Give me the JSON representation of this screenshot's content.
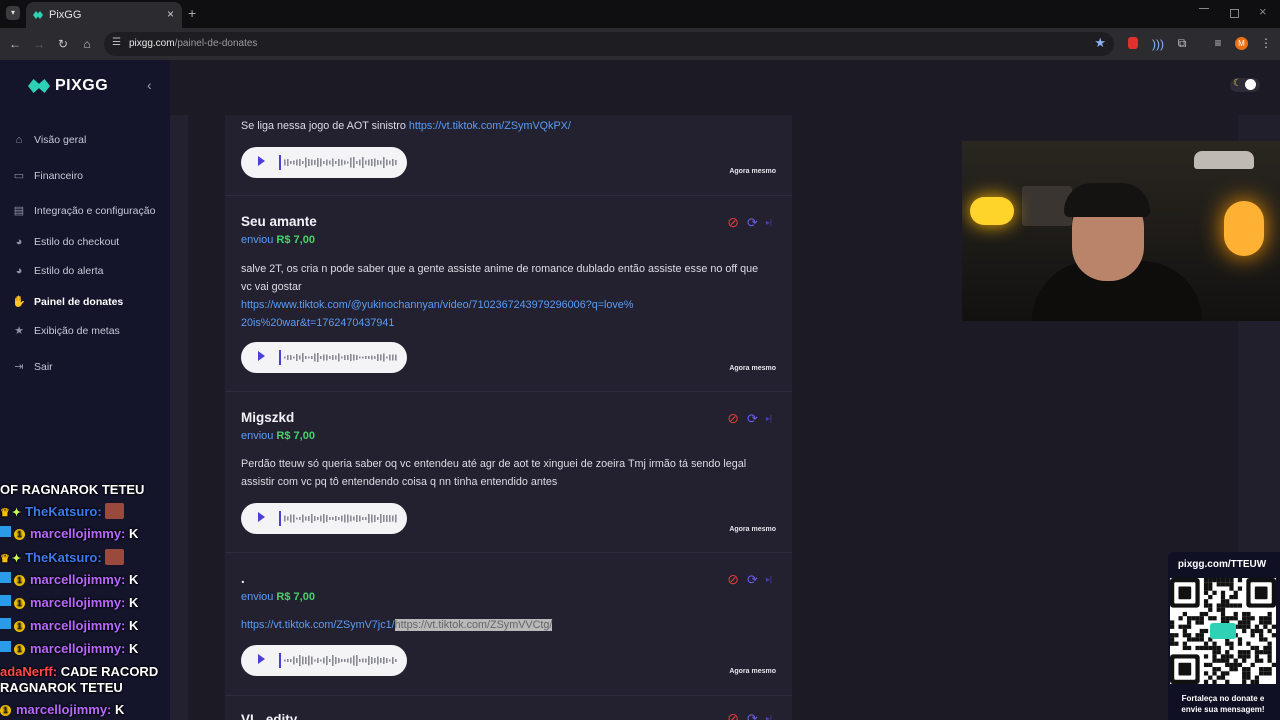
{
  "browser": {
    "tab_title": "PixGG",
    "url_domain": "pixgg.com",
    "url_path": "/painel-de-donates",
    "profile_initial": "M"
  },
  "sidebar": {
    "brand": "PIXGG",
    "items": [
      {
        "label": "Visão geral",
        "icon": "home-icon"
      },
      {
        "label": "Financeiro",
        "icon": "wallet-icon"
      },
      {
        "label": "Integração e configuração",
        "icon": "integration-icon"
      },
      {
        "label": "Estilo do checkout",
        "icon": "palette-icon"
      },
      {
        "label": "Estilo do alerta",
        "icon": "palette-icon"
      },
      {
        "label": "Painel de donates",
        "icon": "donate-hand-icon",
        "active": true
      },
      {
        "label": "Exibição de metas",
        "icon": "star-icon"
      },
      {
        "label": "Sair",
        "icon": "logout-icon"
      }
    ]
  },
  "donations": [
    {
      "message_prefix": "Se liga nessa jogo de AOT sinistro ",
      "link1": "https://vt.tiktok.com/ZSymVQkPX/",
      "time": "Agora mesmo"
    },
    {
      "user": "Seu amante",
      "sent_label": "enviou",
      "amount": "R$ 7,00",
      "message_text": "salve 2T, os cria n pode saber que a gente assiste anime de romance dublado então assiste esse no off que vc vai gostar",
      "link1": "https://www.tiktok.com/@yukinochannyan/video/7102367243979296006?q=love%20is%20war&t=1762470437941",
      "time": "Agora mesmo"
    },
    {
      "user": "Migszkd",
      "sent_label": "enviou",
      "amount": "R$ 7,00",
      "message_text": "Perdão tteuw só queria saber oq vc entendeu até agr de aot te xinguei de zoeira Tmj irmão tá sendo legal assistir com vc pq tô entendendo coisa q nn tinha entendido antes",
      "time": "Agora mesmo"
    },
    {
      "user": ".",
      "sent_label": "enviou",
      "amount": "R$ 7,00",
      "link1": "https://vt.tiktok.com/ZSymV7jc1/",
      "link2": "https://vt.tiktok.com/ZSymVVCtg/",
      "time": "Agora mesmo"
    },
    {
      "user": "VL_edity"
    }
  ],
  "chat": [
    {
      "user": "",
      "text": "OF RAGNAROK TETEU"
    },
    {
      "user": "TheKatsuro:",
      "text": ""
    },
    {
      "user": "marcellojimmy:",
      "text": "K"
    },
    {
      "user": "TheKatsuro:",
      "text": ""
    },
    {
      "user": "marcellojimmy:",
      "text": "K"
    },
    {
      "user": "marcellojimmy:",
      "text": "K"
    },
    {
      "user": "marcellojimmy:",
      "text": "K"
    },
    {
      "user": "marcellojimmy:",
      "text": "K"
    },
    {
      "user": "adaNerff:",
      "text": "CADE RACORD"
    },
    {
      "user": "",
      "text": "RAGNAROK TETEU"
    },
    {
      "user": "marcellojimmy:",
      "text": "K"
    }
  ],
  "qr": {
    "url": "pixgg.com/TTEUW",
    "caption_line1": "Fortaleça no donate e",
    "caption_line2": "envie sua mensagem!"
  },
  "colors": {
    "accent_blue": "#5a9cf5",
    "amount_green": "#47d16c",
    "sidebar_bg": "#14152a",
    "chat_name_purple": "#b868ff",
    "brand_teal": "#2fd1b5"
  }
}
